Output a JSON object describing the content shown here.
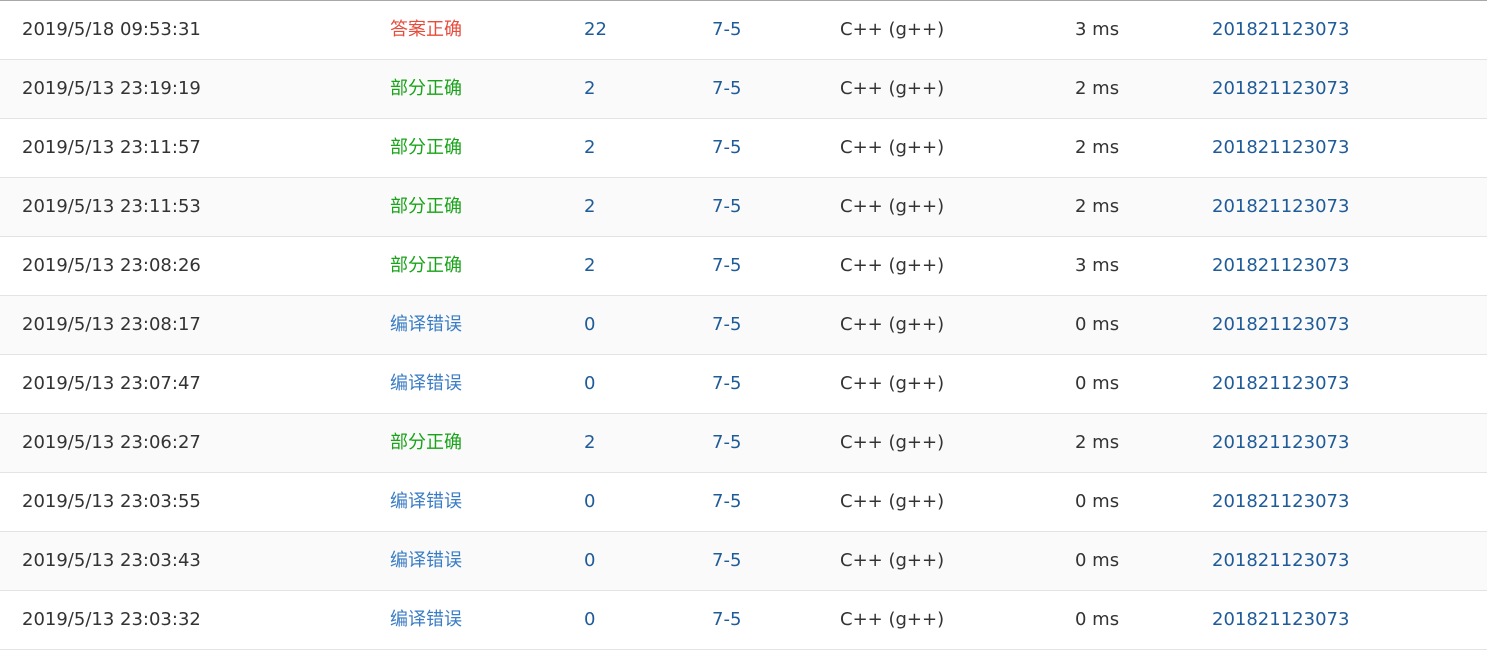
{
  "colors": {
    "accepted": "#e74c3c",
    "partially_accepted": "#19a319",
    "compile_error": "#3b7dc4",
    "link": "#1f5b99"
  },
  "submissions": [
    {
      "time": "2019/5/18 09:53:31",
      "status": "答案正确",
      "status_type": "ac",
      "score": "22",
      "problem": "7-5",
      "language": "C++ (g++)",
      "runtime": "3 ms",
      "user": "201821123073"
    },
    {
      "time": "2019/5/13 23:19:19",
      "status": "部分正确",
      "status_type": "pa",
      "score": "2",
      "problem": "7-5",
      "language": "C++ (g++)",
      "runtime": "2 ms",
      "user": "201821123073"
    },
    {
      "time": "2019/5/13 23:11:57",
      "status": "部分正确",
      "status_type": "pa",
      "score": "2",
      "problem": "7-5",
      "language": "C++ (g++)",
      "runtime": "2 ms",
      "user": "201821123073"
    },
    {
      "time": "2019/5/13 23:11:53",
      "status": "部分正确",
      "status_type": "pa",
      "score": "2",
      "problem": "7-5",
      "language": "C++ (g++)",
      "runtime": "2 ms",
      "user": "201821123073"
    },
    {
      "time": "2019/5/13 23:08:26",
      "status": "部分正确",
      "status_type": "pa",
      "score": "2",
      "problem": "7-5",
      "language": "C++ (g++)",
      "runtime": "3 ms",
      "user": "201821123073"
    },
    {
      "time": "2019/5/13 23:08:17",
      "status": "编译错误",
      "status_type": "ce",
      "score": "0",
      "problem": "7-5",
      "language": "C++ (g++)",
      "runtime": "0 ms",
      "user": "201821123073"
    },
    {
      "time": "2019/5/13 23:07:47",
      "status": "编译错误",
      "status_type": "ce",
      "score": "0",
      "problem": "7-5",
      "language": "C++ (g++)",
      "runtime": "0 ms",
      "user": "201821123073"
    },
    {
      "time": "2019/5/13 23:06:27",
      "status": "部分正确",
      "status_type": "pa",
      "score": "2",
      "problem": "7-5",
      "language": "C++ (g++)",
      "runtime": "2 ms",
      "user": "201821123073"
    },
    {
      "time": "2019/5/13 23:03:55",
      "status": "编译错误",
      "status_type": "ce",
      "score": "0",
      "problem": "7-5",
      "language": "C++ (g++)",
      "runtime": "0 ms",
      "user": "201821123073"
    },
    {
      "time": "2019/5/13 23:03:43",
      "status": "编译错误",
      "status_type": "ce",
      "score": "0",
      "problem": "7-5",
      "language": "C++ (g++)",
      "runtime": "0 ms",
      "user": "201821123073"
    },
    {
      "time": "2019/5/13 23:03:32",
      "status": "编译错误",
      "status_type": "ce",
      "score": "0",
      "problem": "7-5",
      "language": "C++ (g++)",
      "runtime": "0 ms",
      "user": "201821123073"
    }
  ]
}
